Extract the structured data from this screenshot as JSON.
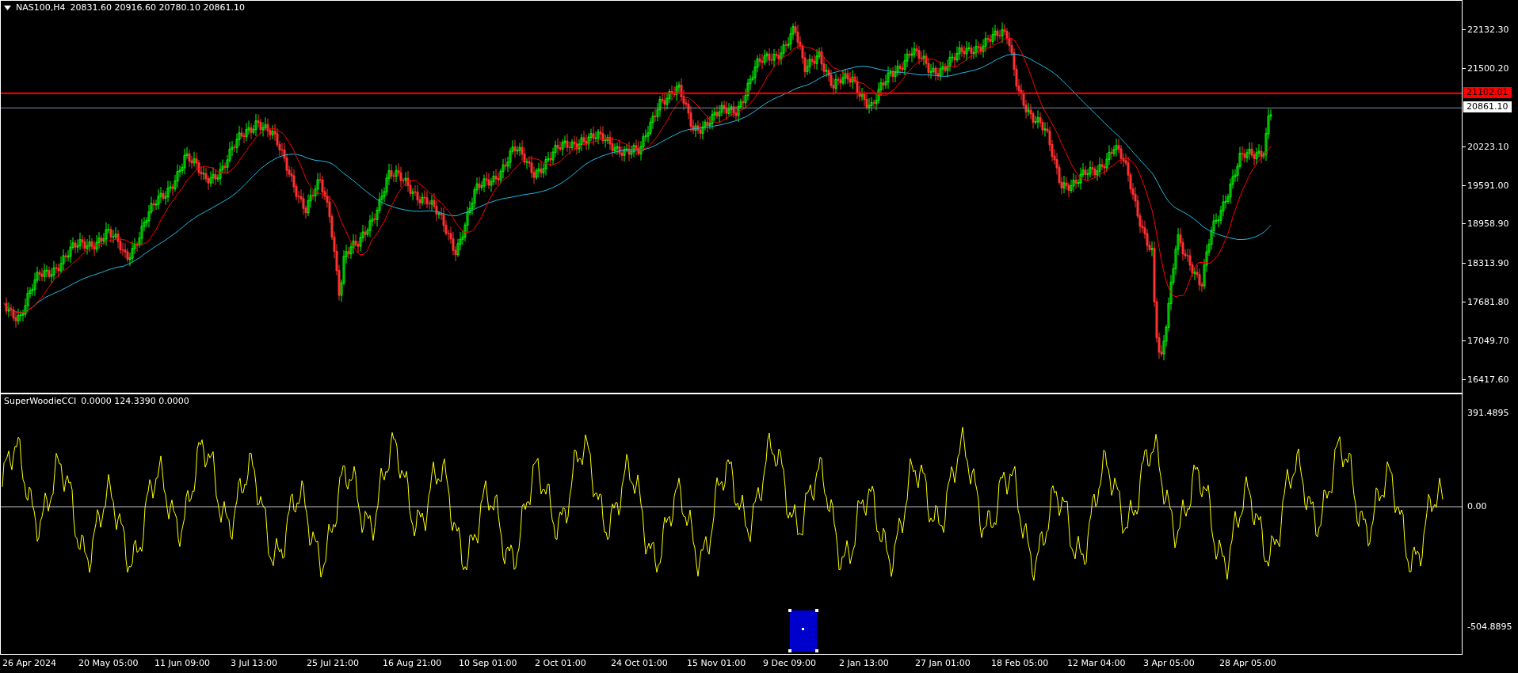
{
  "chart": {
    "title": "NAS100,H4",
    "ohlc": "20831.60 20916.60 20780.10 20861.10"
  },
  "price_axis": {
    "labels": [
      "22132.30",
      "21500.20",
      "20223.10",
      "19591.00",
      "18958.90",
      "18313.90",
      "17681.80",
      "17049.70",
      "16417.60"
    ],
    "level_line": "21102.01",
    "current_price": "20861.10"
  },
  "indicator": {
    "name": "SuperWoodieCCI",
    "values": "0.0000 124.3390 0.0000",
    "axis_labels": [
      "391.4895",
      "0.00",
      "-504.8895"
    ]
  },
  "time_axis": [
    "26 Apr 2024",
    "20 May 05:00",
    "11 Jun 09:00",
    "3 Jul 13:00",
    "25 Jul 21:00",
    "16 Aug 21:00",
    "10 Sep 01:00",
    "2 Oct 01:00",
    "24 Oct 01:00",
    "15 Nov 01:00",
    "9 Dec 09:00",
    "2 Jan 13:00",
    "27 Jan 01:00",
    "18 Feb 05:00",
    "12 Mar 04:00",
    "3 Apr 05:00",
    "28 Apr 05:00"
  ]
}
